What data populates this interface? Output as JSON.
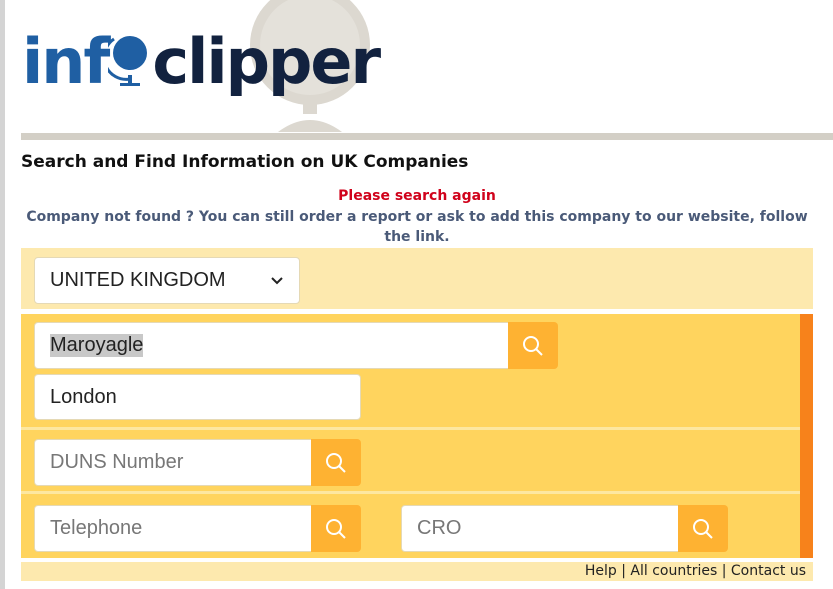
{
  "logo": {
    "part1": "info",
    "part2": "clipper"
  },
  "page": {
    "title": "Search and Find Information on UK Companies",
    "error": "Please search again",
    "note": "Company not found ? You can still order a report or ask to add this company to our website, follow the link."
  },
  "form": {
    "country": "UNITED KINGDOM",
    "company_name": "Maroyagle",
    "city": "London",
    "duns_placeholder": "DUNS Number",
    "telephone_placeholder": "Telephone",
    "cro_placeholder": "CRO"
  },
  "footer": {
    "links": [
      "Help",
      "All countries",
      "Contact us"
    ],
    "separator": "|"
  },
  "colors": {
    "panel_light": "#fde9ae",
    "panel": "#ffd45e",
    "accent": "#f7821b",
    "button": "#feb232",
    "error": "#d0021b"
  }
}
